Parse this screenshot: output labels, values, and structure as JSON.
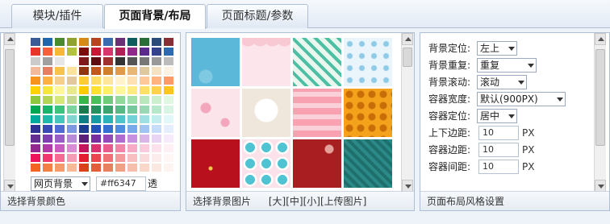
{
  "tabs": [
    {
      "label": "模块/插件"
    },
    {
      "label": "页面背景/布局"
    },
    {
      "label": "页面标题/参数"
    }
  ],
  "active_tab": 1,
  "color_panel": {
    "footer": "选择背景颜色",
    "target_select": "网页背景",
    "color_value": "#ff6347",
    "transparent_label": "透明",
    "swatches": [
      [
        "#3b5b96",
        "#1f66ad",
        "#4d8a2f",
        "#8fa32c",
        "#d68a16",
        "#b44422",
        "#3a6bb0",
        "#6b2f75",
        "#0f5c5e",
        "#2a6e37",
        "#2b4c7a",
        "#8a2e35"
      ],
      [
        "#e7352a",
        "#f55f3a",
        "#f8b739",
        "#b5c33a",
        "#7a0c0c",
        "#c41a33",
        "#d7356b",
        "#b11f57",
        "#8f2a8c",
        "#5a2a8c",
        "#33428a",
        "#2c6bb2"
      ],
      [
        "#cbcbcb",
        "#a0a0a0",
        "#e6e6e6",
        "#ffffff",
        "#7c1a1a",
        "#5c0d0d",
        "#a03030",
        "#333333",
        "#555555",
        "#777777",
        "#999999",
        "#bcbcbc"
      ],
      [
        "#f4b89a",
        "#e67e62",
        "#f5c34e",
        "#fbe39a",
        "#8f3510",
        "#c0571f",
        "#d3802b",
        "#e19a4a",
        "#e7b777",
        "#dfc79e",
        "#f6e1c2",
        "#fbf2e3"
      ],
      [
        "#f7941d",
        "#fbb040",
        "#f6d08a",
        "#e2c89a",
        "#ffcc33",
        "#ffdd66",
        "#ffe699",
        "#fff2cc",
        "#ffe0b3",
        "#ffc899",
        "#ffb380",
        "#ff9966"
      ],
      [
        "#ffd200",
        "#f6e53b",
        "#fff79a",
        "#e8e88c",
        "#ffcc00",
        "#ffe033",
        "#fff066",
        "#fff799",
        "#ffeb80",
        "#ffe066",
        "#ffd24d",
        "#ffc61a"
      ],
      [
        "#8dc63f",
        "#b4d455",
        "#d6e878",
        "#c0d890",
        "#39b54a",
        "#4cbf5a",
        "#6dcc77",
        "#90d99a",
        "#a4e0a9",
        "#b8e8bc",
        "#ccf0ce",
        "#e0f7e1"
      ],
      [
        "#00a651",
        "#19b36a",
        "#3cc47f",
        "#7ad49f",
        "#1c7a4f",
        "#2a8f5e",
        "#3ba56f",
        "#58b886",
        "#78c89d",
        "#98d8b4",
        "#b8e8cb",
        "#d8f4e2"
      ],
      [
        "#00a99d",
        "#1fb8ad",
        "#44c6bc",
        "#7fd6cf",
        "#0f7f83",
        "#179aa0",
        "#2bb3ba",
        "#4dc4ca",
        "#72d1d6",
        "#9ddfe2",
        "#c2ecee",
        "#e2f7f8"
      ],
      [
        "#2e3192",
        "#3a4ab5",
        "#4f6ad0",
        "#7d97e3",
        "#1b3c8f",
        "#2352b5",
        "#3370d0",
        "#4f8de0",
        "#78aaea",
        "#a1c5f2",
        "#c7dcf8",
        "#e4eefc"
      ],
      [
        "#662d91",
        "#7f3fb0",
        "#9a5cc7",
        "#b88ad8",
        "#5b1f7a",
        "#76309c",
        "#9448ba",
        "#af6bd0",
        "#c691df",
        "#dab5ea",
        "#e9d4f3",
        "#f5ebfa"
      ],
      [
        "#92278f",
        "#b03aa8",
        "#c85bbf",
        "#da8bd3",
        "#c2185b",
        "#d6336f",
        "#e85a8c",
        "#f184a9",
        "#f7aac5",
        "#fbcbdd",
        "#fde1ec",
        "#fef0f5"
      ],
      [
        "#ed145b",
        "#f0386f",
        "#f46a92",
        "#f79ab5",
        "#e11f2f",
        "#e8474f",
        "#ef7075",
        "#f4999c",
        "#f8bfc0",
        "#fbdadb",
        "#fdecec",
        "#fff6f6"
      ],
      [
        "#f26522",
        "#f47f45",
        "#f6996b",
        "#f9b896",
        "#d8431a",
        "#e0603c",
        "#e8805f",
        "#efa085",
        "#f5c0ab",
        "#f9d8ca",
        "#fbe9e1",
        "#fdf4f0"
      ]
    ]
  },
  "image_panel": {
    "footer": "选择背景图片",
    "size_links": [
      "[大]",
      "[中]",
      "[小]",
      "[上传图片]"
    ],
    "thumbnails": [
      {
        "name": "light-blue",
        "colors": [
          "#5cb8d8",
          "#7fc9e3"
        ]
      },
      {
        "name": "pink-scallop",
        "colors": [
          "#f9c9d3",
          "#fde6eb"
        ]
      },
      {
        "name": "teal-lattice",
        "colors": [
          "#4dbfa3",
          "#e9f7ef"
        ]
      },
      {
        "name": "blue-snowflake",
        "colors": [
          "#eaf5fb",
          "#8fcbe6"
        ]
      },
      {
        "name": "pink-hearts",
        "colors": [
          "#fbe4ea",
          "#f3a7bd"
        ]
      },
      {
        "name": "beige-flower",
        "colors": [
          "#efe6dc",
          "#ffffff"
        ]
      },
      {
        "name": "pink-stripes",
        "colors": [
          "#f7a1b1",
          "#fbd0d9"
        ]
      },
      {
        "name": "orange-damask",
        "colors": [
          "#f4a21b",
          "#c86d08"
        ]
      },
      {
        "name": "red-sparkle",
        "colors": [
          "#b8101c",
          "#d43a2a"
        ]
      },
      {
        "name": "pink-circles",
        "colors": [
          "#fbe2ea",
          "#4fc3d1"
        ]
      },
      {
        "name": "dark-red-snow",
        "colors": [
          "#a81e21",
          "#7c1015"
        ]
      },
      {
        "name": "teal-diagonal",
        "colors": [
          "#2b8a87",
          "#1f6f6d"
        ]
      }
    ]
  },
  "layout_panel": {
    "footer": "页面布局风格设置",
    "rows": [
      {
        "label": "背景定位:",
        "type": "select",
        "value": "左上"
      },
      {
        "label": "背景重复:",
        "type": "select",
        "value": "重复"
      },
      {
        "label": "背景滚动:",
        "type": "select",
        "value": "滚动"
      },
      {
        "label": "容器宽度:",
        "type": "select",
        "value": "默认(900PX)"
      },
      {
        "label": "容器定位:",
        "type": "select",
        "value": "居中"
      },
      {
        "label": "上下边距:",
        "type": "input",
        "value": "10",
        "unit": "PX"
      },
      {
        "label": "容器边距:",
        "type": "input",
        "value": "10",
        "unit": "PX"
      },
      {
        "label": "容器间距:",
        "type": "input",
        "value": "10",
        "unit": "PX"
      }
    ]
  }
}
